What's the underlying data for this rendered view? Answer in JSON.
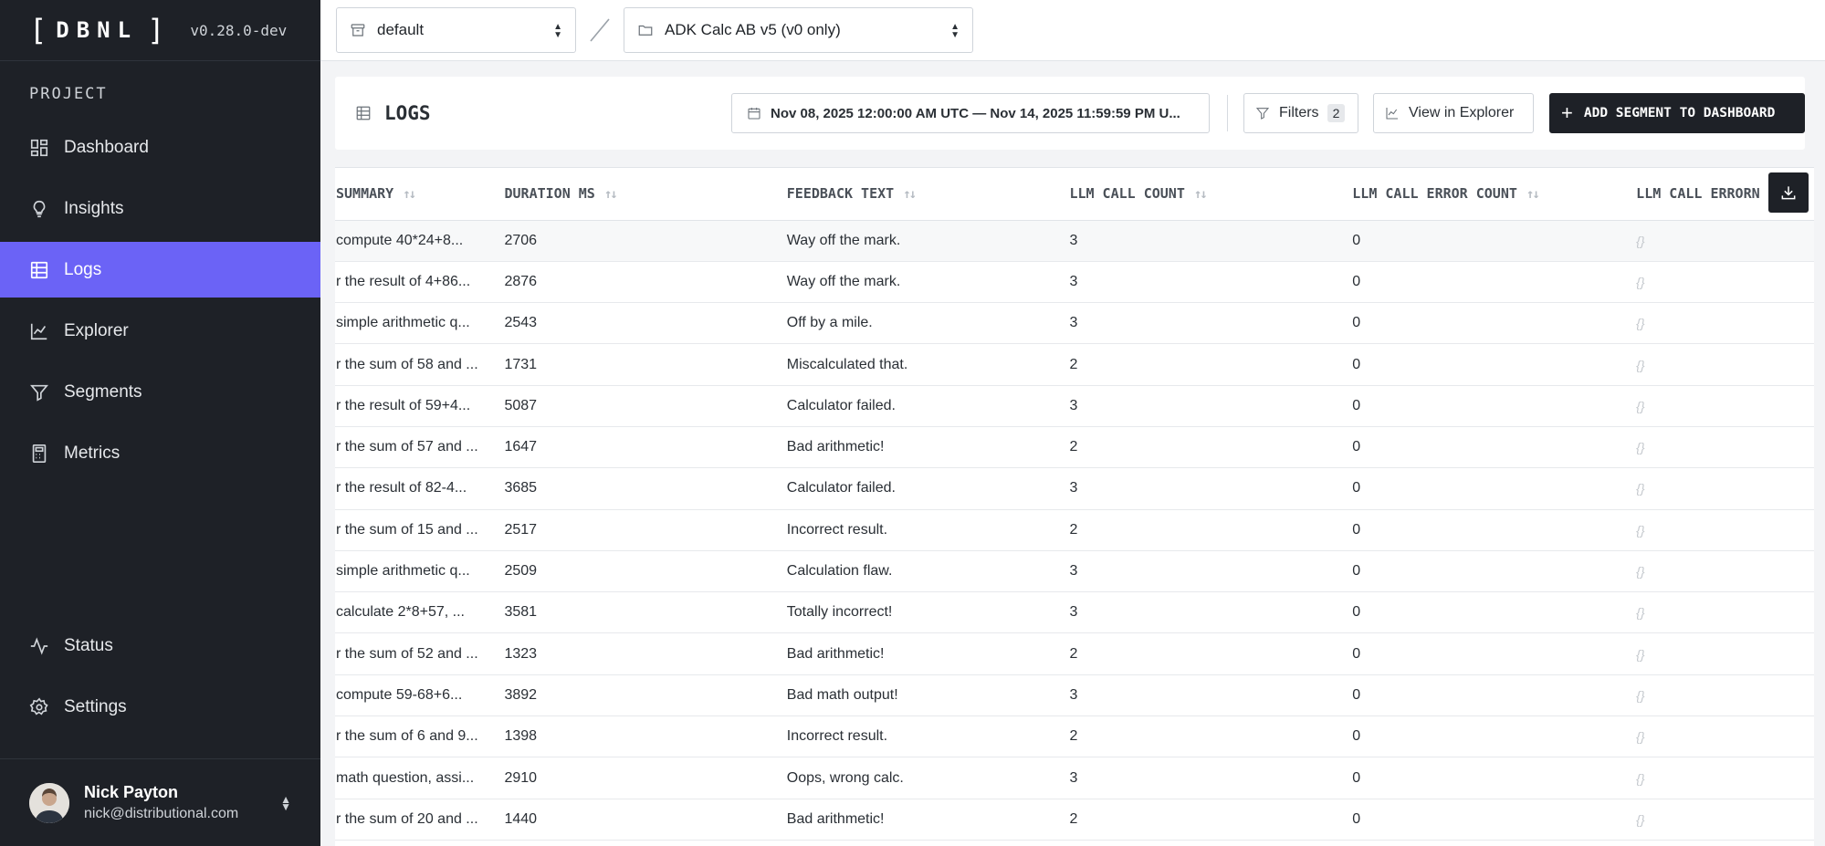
{
  "app": {
    "logo_text": "DBNL",
    "version": "v0.28.0-dev"
  },
  "sidebar": {
    "section_label": "PROJECT",
    "items": [
      {
        "label": "Dashboard",
        "icon": "dashboard-icon"
      },
      {
        "label": "Insights",
        "icon": "lightbulb-icon"
      },
      {
        "label": "Logs",
        "icon": "table-icon",
        "active": true
      },
      {
        "label": "Explorer",
        "icon": "line-chart-icon"
      },
      {
        "label": "Segments",
        "icon": "filter-icon"
      },
      {
        "label": "Metrics",
        "icon": "calculator-icon"
      }
    ],
    "bottom_items": [
      {
        "label": "Status",
        "icon": "activity-icon"
      },
      {
        "label": "Settings",
        "icon": "gear-icon"
      }
    ],
    "user": {
      "name": "Nick Payton",
      "email": "nick@distributional.com"
    }
  },
  "topbar": {
    "project_select": "default",
    "model_select": "ADK Calc AB v5 (v0 only)"
  },
  "header": {
    "title": "LOGS",
    "date_range": "Nov 08, 2025 12:00:00 AM UTC — Nov 14, 2025 11:59:59 PM U...",
    "filters_label": "Filters",
    "filters_count": "2",
    "explorer_label": "View in Explorer",
    "add_label": "ADD SEGMENT TO DASHBOARD"
  },
  "table": {
    "columns": [
      "SUMMARY",
      "DURATION MS",
      "FEEDBACK TEXT",
      "LLM CALL COUNT",
      "LLM CALL ERROR COUNT",
      "LLM CALL ERROR"
    ],
    "last_column_overflow": "N",
    "rows": [
      {
        "summary": "compute 40*24+8...",
        "duration": "2706",
        "feedback": "Way off the mark.",
        "count": "3",
        "errors": "0",
        "error": "{}"
      },
      {
        "summary": "r the result of 4+86...",
        "duration": "2876",
        "feedback": "Way off the mark.",
        "count": "3",
        "errors": "0",
        "error": "{}"
      },
      {
        "summary": "simple arithmetic q...",
        "duration": "2543",
        "feedback": "Off by a mile.",
        "count": "3",
        "errors": "0",
        "error": "{}"
      },
      {
        "summary": "r the sum of 58 and ...",
        "duration": "1731",
        "feedback": "Miscalculated that.",
        "count": "2",
        "errors": "0",
        "error": "{}"
      },
      {
        "summary": "r the result of 59+4...",
        "duration": "5087",
        "feedback": "Calculator failed.",
        "count": "3",
        "errors": "0",
        "error": "{}"
      },
      {
        "summary": "r the sum of 57 and ...",
        "duration": "1647",
        "feedback": "Bad arithmetic!",
        "count": "2",
        "errors": "0",
        "error": "{}"
      },
      {
        "summary": "r the result of 82-4...",
        "duration": "3685",
        "feedback": "Calculator failed.",
        "count": "3",
        "errors": "0",
        "error": "{}"
      },
      {
        "summary": "r the sum of 15 and ...",
        "duration": "2517",
        "feedback": "Incorrect result.",
        "count": "2",
        "errors": "0",
        "error": "{}"
      },
      {
        "summary": "simple arithmetic q...",
        "duration": "2509",
        "feedback": "Calculation flaw.",
        "count": "3",
        "errors": "0",
        "error": "{}"
      },
      {
        "summary": "calculate 2*8+57, ...",
        "duration": "3581",
        "feedback": "Totally incorrect!",
        "count": "3",
        "errors": "0",
        "error": "{}"
      },
      {
        "summary": "r the sum of 52 and ...",
        "duration": "1323",
        "feedback": "Bad arithmetic!",
        "count": "2",
        "errors": "0",
        "error": "{}"
      },
      {
        "summary": "compute 59-68+6...",
        "duration": "3892",
        "feedback": "Bad math output!",
        "count": "3",
        "errors": "0",
        "error": "{}"
      },
      {
        "summary": "r the sum of 6 and 9...",
        "duration": "1398",
        "feedback": "Incorrect result.",
        "count": "2",
        "errors": "0",
        "error": "{}"
      },
      {
        "summary": "math question, assi...",
        "duration": "2910",
        "feedback": "Oops, wrong calc.",
        "count": "3",
        "errors": "0",
        "error": "{}"
      },
      {
        "summary": "r the sum of 20 and ...",
        "duration": "1440",
        "feedback": "Bad arithmetic!",
        "count": "2",
        "errors": "0",
        "error": "{}"
      }
    ]
  }
}
